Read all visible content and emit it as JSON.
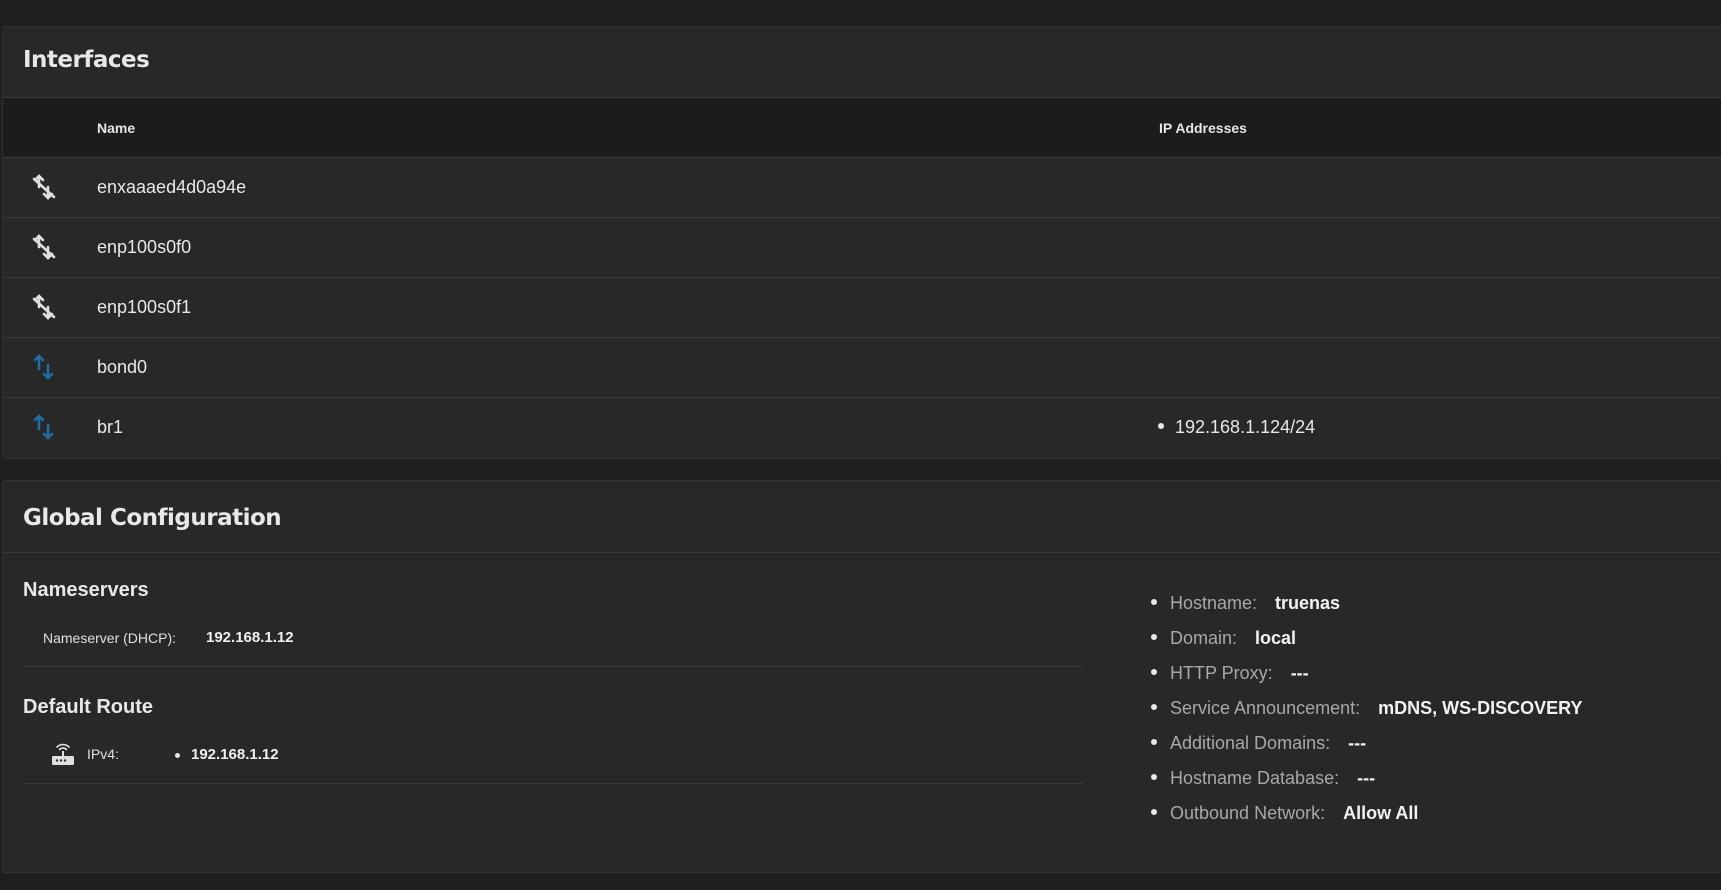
{
  "interfaces": {
    "title": "Interfaces",
    "columns": {
      "name": "Name",
      "ip": "IP Addresses"
    },
    "rows": [
      {
        "name": "enxaaaed4d0a94e",
        "icon": "link-off-icon",
        "ip": ""
      },
      {
        "name": "enp100s0f0",
        "icon": "link-off-icon",
        "ip": ""
      },
      {
        "name": "enp100s0f1",
        "icon": "link-off-icon",
        "ip": ""
      },
      {
        "name": "bond0",
        "icon": "link-up-down-icon",
        "ip": ""
      },
      {
        "name": "br1",
        "icon": "link-up-down-icon",
        "ip": "192.168.1.124/24"
      }
    ]
  },
  "global": {
    "title": "Global Configuration",
    "nameservers": {
      "title": "Nameservers",
      "label": "Nameserver (DHCP):",
      "value": "192.168.1.12"
    },
    "default_route": {
      "title": "Default Route",
      "label": "IPv4:",
      "value": "192.168.1.12",
      "icon": "router-icon"
    },
    "info": [
      {
        "label": "Hostname:",
        "value": "truenas"
      },
      {
        "label": "Domain:",
        "value": "local"
      },
      {
        "label": "HTTP Proxy:",
        "value": "---"
      },
      {
        "label": "Service Announcement:",
        "value": "mDNS, WS-DISCOVERY"
      },
      {
        "label": "Additional Domains:",
        "value": "---"
      },
      {
        "label": "Hostname Database:",
        "value": "---"
      },
      {
        "label": "Outbound Network:",
        "value": "Allow All"
      }
    ]
  },
  "colors": {
    "background": "#1f1f1f",
    "card": "#282828",
    "link_up_icon": "#1e6fa3",
    "link_off_icon": "#e0e0e0"
  }
}
